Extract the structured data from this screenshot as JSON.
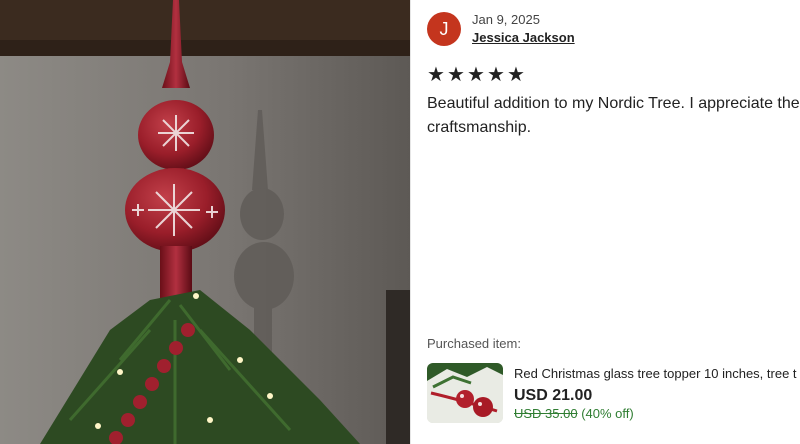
{
  "photo": {
    "alt_icon": "tree-topper-photo"
  },
  "review": {
    "avatar_initial": "J",
    "date": "Jan 9, 2025",
    "author": "Jessica Jackson",
    "rating": 5,
    "stars": [
      "★",
      "★",
      "★",
      "★",
      "★"
    ],
    "text": "Beautiful addition to my Nordic Tree. I appreciate the craftsmanship."
  },
  "purchased": {
    "label": "Purchased item:",
    "title": "Red Christmas glass tree topper 10 inches, tree t",
    "price": "USD 21.00",
    "original_price": "USD 35.00",
    "discount": "(40% off)"
  },
  "colors": {
    "avatar": "#c4351e",
    "discount_green": "#2f7d32"
  }
}
